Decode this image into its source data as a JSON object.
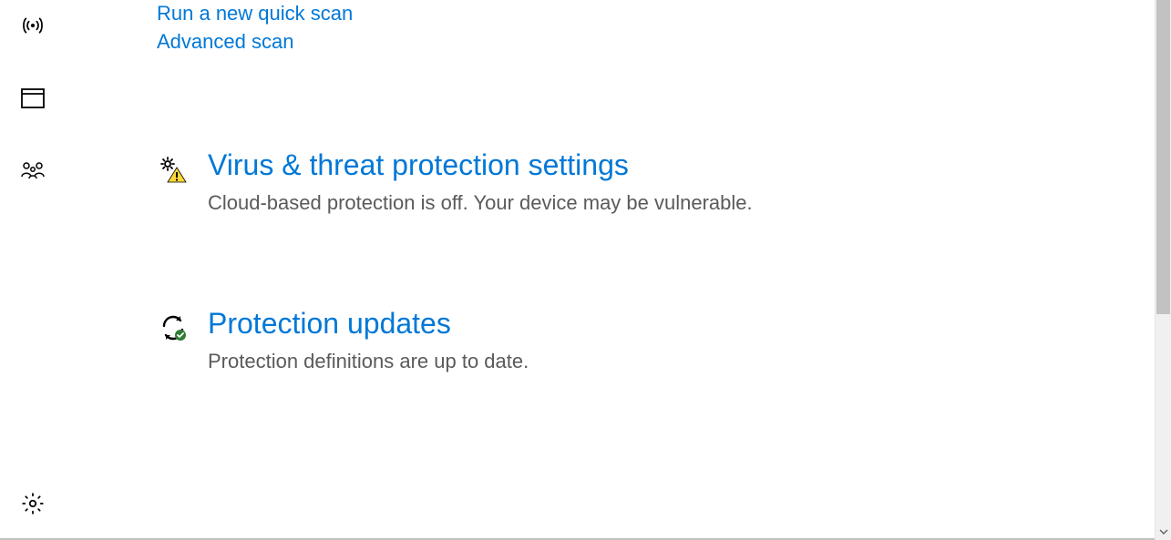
{
  "links": {
    "quick_scan": "Run a new quick scan",
    "advanced_scan": "Advanced scan"
  },
  "sections": {
    "settings": {
      "title": "Virus & threat protection settings",
      "desc": "Cloud-based protection is off. Your device may be vulnerable."
    },
    "updates": {
      "title": "Protection updates",
      "desc": "Protection definitions are up to date."
    }
  }
}
